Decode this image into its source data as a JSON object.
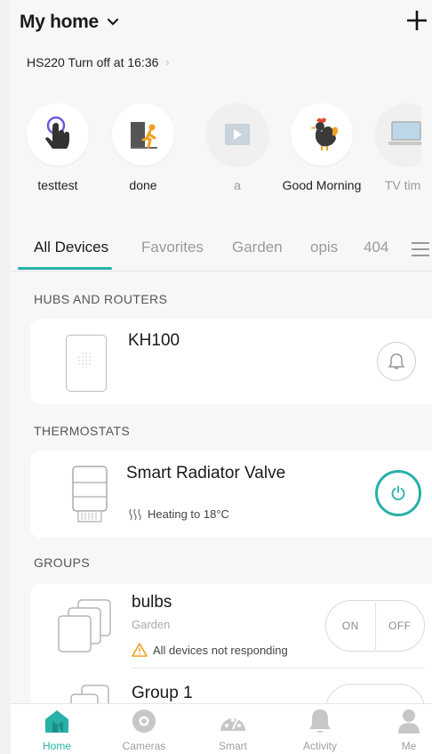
{
  "header": {
    "title": "My home"
  },
  "notice": {
    "text": "HS220 Turn off at 16:36"
  },
  "scenes": [
    {
      "label": "testtest",
      "icon": "hand-pointer-icon"
    },
    {
      "label": "done",
      "icon": "person-exit-door-icon"
    },
    {
      "label": "a",
      "icon": "play-icon"
    },
    {
      "label": "Good Morning",
      "icon": "rooster-icon"
    },
    {
      "label": "TV time",
      "icon": "tv-icon"
    }
  ],
  "tabs": [
    "All Devices",
    "Favorites",
    "Garden",
    "opis",
    "404"
  ],
  "sections": {
    "hubs": "HUBS AND ROUTERS",
    "thermostats": "THERMOSTATS",
    "groups": "GROUPS"
  },
  "devices": {
    "hub": {
      "name": "KH100"
    },
    "thermostat": {
      "name": "Smart Radiator Valve",
      "status": "Heating to 18°C"
    }
  },
  "groups": [
    {
      "name": "bulbs",
      "location": "Garden",
      "warning": "All devices not responding",
      "on_label": "ON",
      "off_label": "OFF"
    },
    {
      "name": "Group 1"
    }
  ],
  "nav": [
    "Home",
    "Cameras",
    "Smart",
    "Activity",
    "Me"
  ],
  "colors": {
    "accent": "#27b1a8",
    "warning": "#f0a020"
  }
}
